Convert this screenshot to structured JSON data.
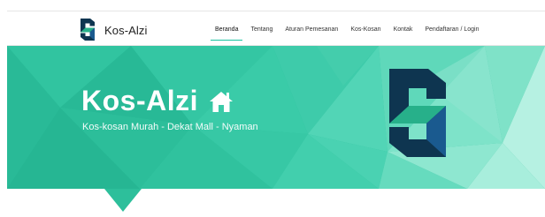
{
  "brand": {
    "name": "Kos-Alzi"
  },
  "nav": {
    "items": [
      {
        "label": "Beranda",
        "active": true
      },
      {
        "label": "Tentang"
      },
      {
        "label": "Aturan Pemesanan"
      },
      {
        "label": "Kos-Kosan"
      },
      {
        "label": "Kontak"
      },
      {
        "label": "Pendaftaran / Login"
      }
    ]
  },
  "hero": {
    "title": "Kos-Alzi",
    "subtitle": "Kos-kosan Murah - Dekat Mall - Nyaman",
    "title_icon": "home-icon"
  },
  "colors": {
    "accent": "#2dbf9b",
    "logo_dark": "#0e3550",
    "logo_green": "#27b08a",
    "logo_blue": "#1a5a8f"
  }
}
